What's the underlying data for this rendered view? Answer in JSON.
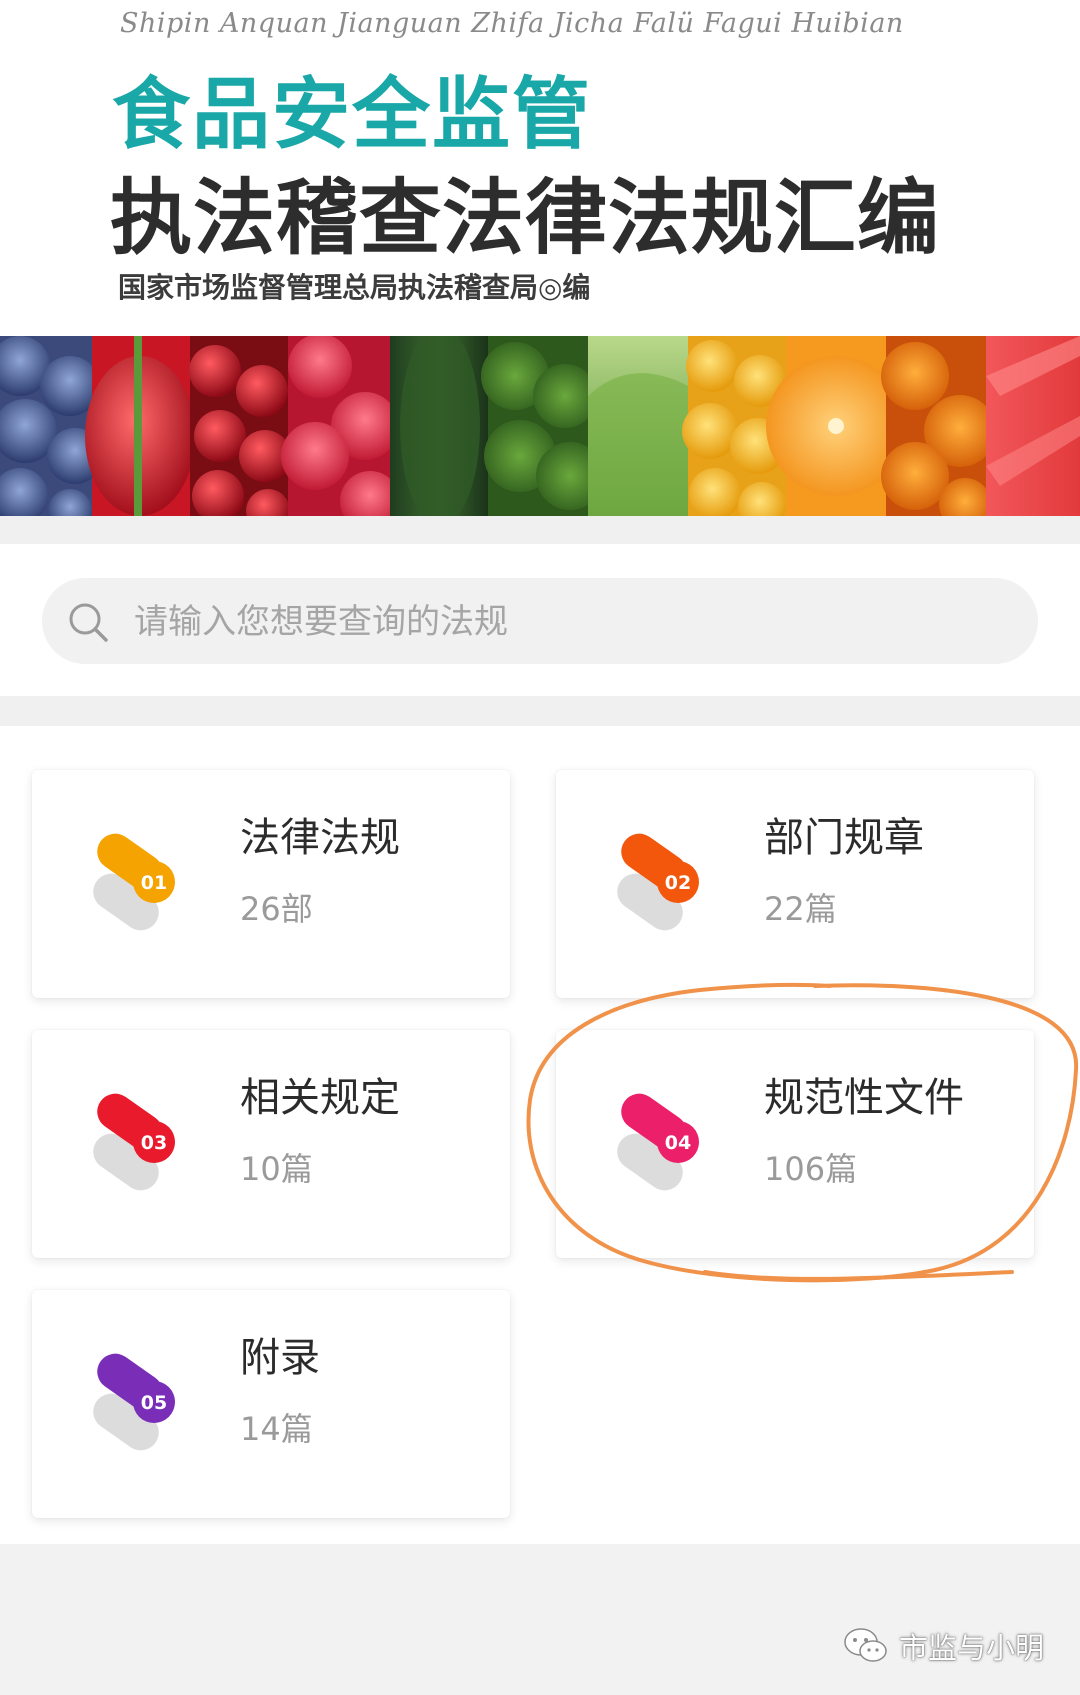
{
  "header": {
    "pinyin_title": "Shipin Anquan Jianguan Zhifa Jicha Falü Fagui Huibian",
    "title_line1": "食品安全监管",
    "title_line2": "执法稽查法律法规汇编",
    "editor": "国家市场监督管理总局执法稽查局◎编"
  },
  "search": {
    "placeholder": "请输入您想要查询的法规",
    "icon": "search-icon"
  },
  "categories": [
    {
      "number": "01",
      "title": "法律法规",
      "count": "26部",
      "color": "#f5a300"
    },
    {
      "number": "02",
      "title": "部门规章",
      "count": "22篇",
      "color": "#f2570c"
    },
    {
      "number": "03",
      "title": "相关规定",
      "count": "10篇",
      "color": "#e81a2c"
    },
    {
      "number": "04",
      "title": "规范性文件",
      "count": "106篇",
      "color": "#ec1f6a",
      "highlighted": true
    },
    {
      "number": "05",
      "title": "附录",
      "count": "14篇",
      "color": "#7a2eb8"
    }
  ],
  "watermark": {
    "icon": "wechat-icon",
    "text": "市监与小明"
  },
  "colors": {
    "title_teal": "#1aa7a8",
    "highlight_circle": "#f0924a"
  }
}
